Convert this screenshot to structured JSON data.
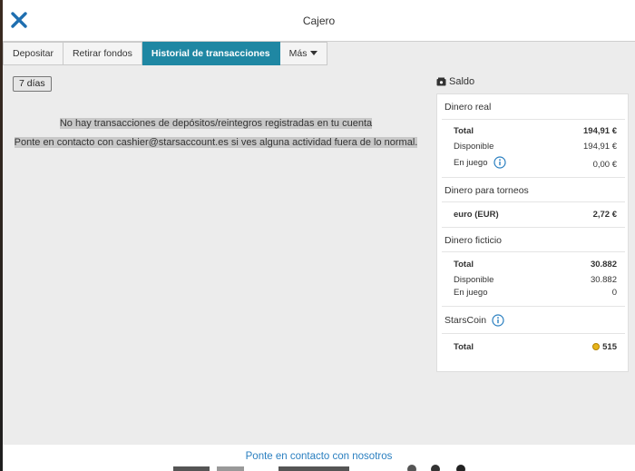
{
  "window": {
    "title": "Cajero"
  },
  "tabs": [
    {
      "label": "Depositar",
      "active": false
    },
    {
      "label": "Retirar fondos",
      "active": false
    },
    {
      "label": "Historial de transacciones",
      "active": true
    },
    {
      "label": "Más",
      "active": false
    }
  ],
  "history": {
    "period_label": "7 días",
    "empty_message": "No hay transacciones de depósitos/reintegros registradas en tu cuenta",
    "contact_message": "Ponte en contacto con cashier@starsaccount.es si ves alguna actividad fuera de lo normal."
  },
  "balance": {
    "title": "Saldo",
    "real_money": {
      "title": "Dinero real",
      "total_label": "Total",
      "total_value": "194,91 €",
      "available_label": "Disponible",
      "available_value": "194,91 €",
      "in_play_label": "En juego",
      "in_play_value": "0,00 €"
    },
    "tournament_money": {
      "title": "Dinero para torneos",
      "currency_label": "euro (EUR)",
      "currency_value": "2,72 €"
    },
    "play_money": {
      "title": "Dinero ficticio",
      "total_label": "Total",
      "total_value": "30.882",
      "available_label": "Disponible",
      "available_value": "30.882",
      "in_play_label": "En juego",
      "in_play_value": "0"
    },
    "stars_coin": {
      "title": "StarsCoin",
      "total_label": "Total",
      "total_value": "515"
    }
  },
  "footer": {
    "contact_link": "Ponte en contacto con nosotros"
  },
  "colors": {
    "accent": "#1f87a3",
    "close_icon": "#1f6fb0",
    "link": "#2a7fc0",
    "info_icon": "#2a7fc0",
    "coin": "#e7b51a"
  }
}
